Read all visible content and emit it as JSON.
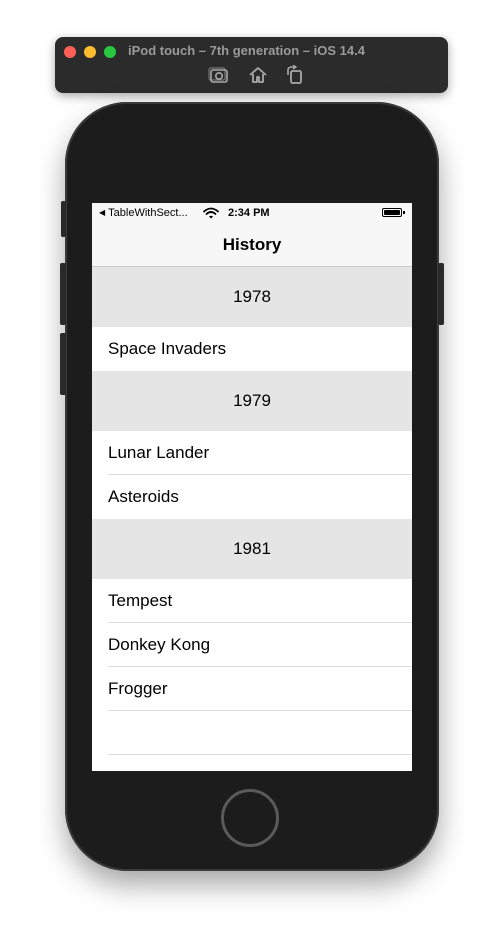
{
  "simulator": {
    "title": "iPod touch – 7th generation – iOS 14.4",
    "toolbar_icons": [
      "screenshot-icon",
      "home-icon",
      "rotate-icon"
    ]
  },
  "status_bar": {
    "back_app": "TableWithSect...",
    "time": "2:34 PM"
  },
  "nav": {
    "title": "History"
  },
  "sections": [
    {
      "header": "1978",
      "rows": [
        "Space Invaders"
      ]
    },
    {
      "header": "1979",
      "rows": [
        "Lunar Lander",
        "Asteroids"
      ]
    },
    {
      "header": "1981",
      "rows": [
        "Tempest",
        "Donkey Kong",
        "Frogger"
      ]
    }
  ],
  "colors": {
    "section_header_bg": "#e5e5e5",
    "device_body": "#1c1c1c",
    "nav_bar_bg": "#f7f7f7"
  }
}
